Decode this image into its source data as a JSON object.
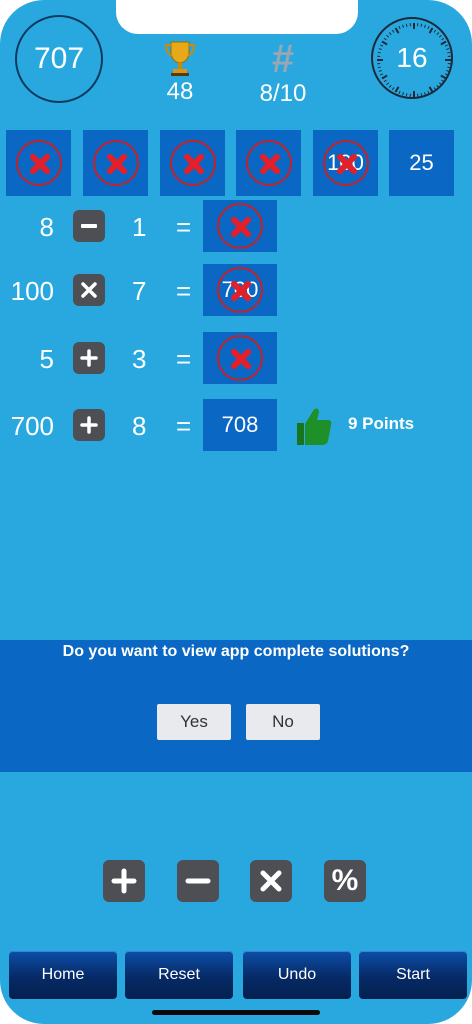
{
  "header": {
    "target": "707",
    "trophy_icon": "trophy-icon",
    "trophy_value": "48",
    "round_symbol": "#",
    "round_value": "8/10",
    "timer": "16"
  },
  "tiles": [
    {
      "value": "",
      "crossed": true
    },
    {
      "value": "",
      "crossed": true
    },
    {
      "value": "",
      "crossed": true
    },
    {
      "value": "",
      "crossed": true
    },
    {
      "value": "100",
      "crossed": true
    },
    {
      "value": "25",
      "crossed": false
    }
  ],
  "rows": [
    {
      "a": "8",
      "op": "minus",
      "b": "1",
      "eq": "=",
      "result": "",
      "crossed": true
    },
    {
      "a": "100",
      "op": "times",
      "b": "7",
      "eq": "=",
      "result": "700",
      "crossed": true
    },
    {
      "a": "5",
      "op": "plus",
      "b": "3",
      "eq": "=",
      "result": "",
      "crossed": true
    },
    {
      "a": "700",
      "op": "plus",
      "b": "8",
      "eq": "=",
      "result": "708",
      "crossed": false
    }
  ],
  "feedback": {
    "icon": "thumbs-up-icon",
    "points": "9 Points"
  },
  "dialog": {
    "question": "Do you want to view app complete solutions?",
    "yes": "Yes",
    "no": "No"
  },
  "operators": [
    "plus-icon",
    "minus-icon",
    "times-icon",
    "percent-icon"
  ],
  "operator_percent_label": "%",
  "nav": {
    "home": "Home",
    "reset": "Reset",
    "undo": "Undo",
    "start": "Start"
  },
  "colors": {
    "background": "#28a8df",
    "tile": "#0a67c4",
    "cross": "#e31f2a",
    "operator": "#4e4f55",
    "thumb": "#1f8f2a"
  }
}
